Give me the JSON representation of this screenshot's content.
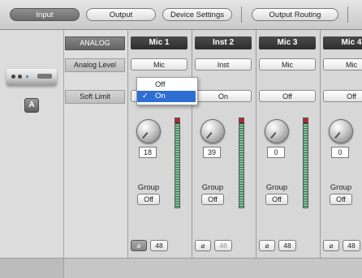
{
  "tabs": [
    {
      "label": "Input",
      "active": true
    },
    {
      "label": "Output",
      "active": false
    },
    {
      "label": "Device Settings",
      "active": false
    },
    {
      "label": "Output Routing",
      "active": false
    }
  ],
  "device": {
    "badge": "A"
  },
  "row_labels": {
    "header": "ANALOG",
    "analog_level": "Analog Level",
    "soft_limit": "Soft Limit"
  },
  "channels": [
    {
      "name": "Mic 1",
      "level": "Mic",
      "soft_limit": "",
      "gain": "18",
      "group_label": "Group",
      "group": "Off",
      "phase": "⌀",
      "phantom": "48"
    },
    {
      "name": "Inst 2",
      "level": "Inst",
      "soft_limit": "On",
      "gain": "39",
      "group_label": "Group",
      "group": "Off",
      "phase": "⌀",
      "phantom": "48"
    },
    {
      "name": "Mic 3",
      "level": "Mic",
      "soft_limit": "Off",
      "gain": "0",
      "group_label": "Group",
      "group": "Off",
      "phase": "⌀",
      "phantom": "48"
    },
    {
      "name": "Mic 4",
      "level": "Mic",
      "soft_limit": "Off",
      "gain": "0",
      "group_label": "Group",
      "group": "Off",
      "phase": "⌀",
      "phantom": "48"
    }
  ],
  "popup": {
    "options": [
      {
        "label": "Off",
        "check": ""
      },
      {
        "label": "On",
        "check": "✓"
      }
    ]
  }
}
